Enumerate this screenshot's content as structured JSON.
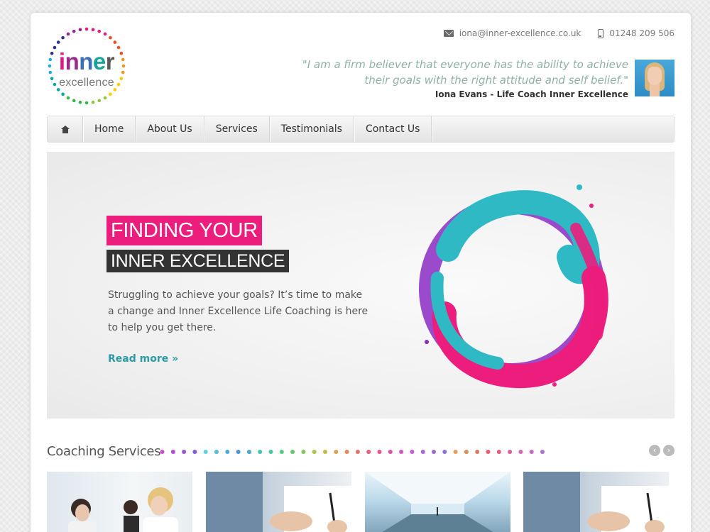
{
  "logo": {
    "word1_letters": [
      "i",
      "n",
      "n",
      "e",
      "r"
    ],
    "word1_colors": [
      "#e2197f",
      "#9c2a8e",
      "#3d6fb6",
      "#1aa39a",
      "#5a5a5a"
    ],
    "word2": "excellence",
    "ring_colors": [
      "#e2197f",
      "#f04e23",
      "#f7941d",
      "#ffcb05",
      "#8dc63f",
      "#39b54a",
      "#00a99d",
      "#27aae1",
      "#2e3192",
      "#92278f"
    ]
  },
  "contact": {
    "email": "iona@inner-excellence.co.uk",
    "phone": "01248 209 506"
  },
  "quote": {
    "line1": "\"I am a firm believer that everyone has the ability to achieve",
    "line2": "their goals with the right attitude and self belief.\"",
    "author": "Iona Evans - Life Coach Inner Excellence"
  },
  "nav": {
    "items": [
      "Home",
      "About Us",
      "Services",
      "Testimonials",
      "Contact Us"
    ]
  },
  "hero": {
    "headline1": "FINDING YOUR",
    "headline2": "INNER EXCELLENCE",
    "text": "Struggling to achieve your goals?  It’s time to make a change and Inner Excellence Life Coaching is here to help you get there.",
    "read_more": "Read more  »",
    "colors": {
      "pink": "#ec1d7d",
      "teal": "#2fb9c5",
      "purple": "#8a2bc2"
    }
  },
  "services": {
    "title": "Coaching Services",
    "prev": "‹",
    "next": "›",
    "dot_colors": [
      "#c94fd0",
      "#b24fd5",
      "#9b55d8",
      "#7f5dd8",
      "#5fd0d8",
      "#54bcd9",
      "#4da8da",
      "#4a93d9",
      "#4aa8c9",
      "#47c2b0",
      "#4bc79b",
      "#56c984",
      "#66c46d",
      "#87c45a",
      "#a9c44f",
      "#c4b84c",
      "#d9a050",
      "#e08858",
      "#e57264",
      "#e55f76",
      "#e5548c",
      "#de52a6",
      "#d456c0",
      "#c45ccf",
      "#b064d6",
      "#9c6bd9",
      "#8a72db",
      "#e89a56",
      "#e08a5a",
      "#d97a62",
      "#e45e6c",
      "#e15e80",
      "#dc5f98",
      "#d264b4",
      "#c56ac8",
      "#b372d3"
    ]
  }
}
